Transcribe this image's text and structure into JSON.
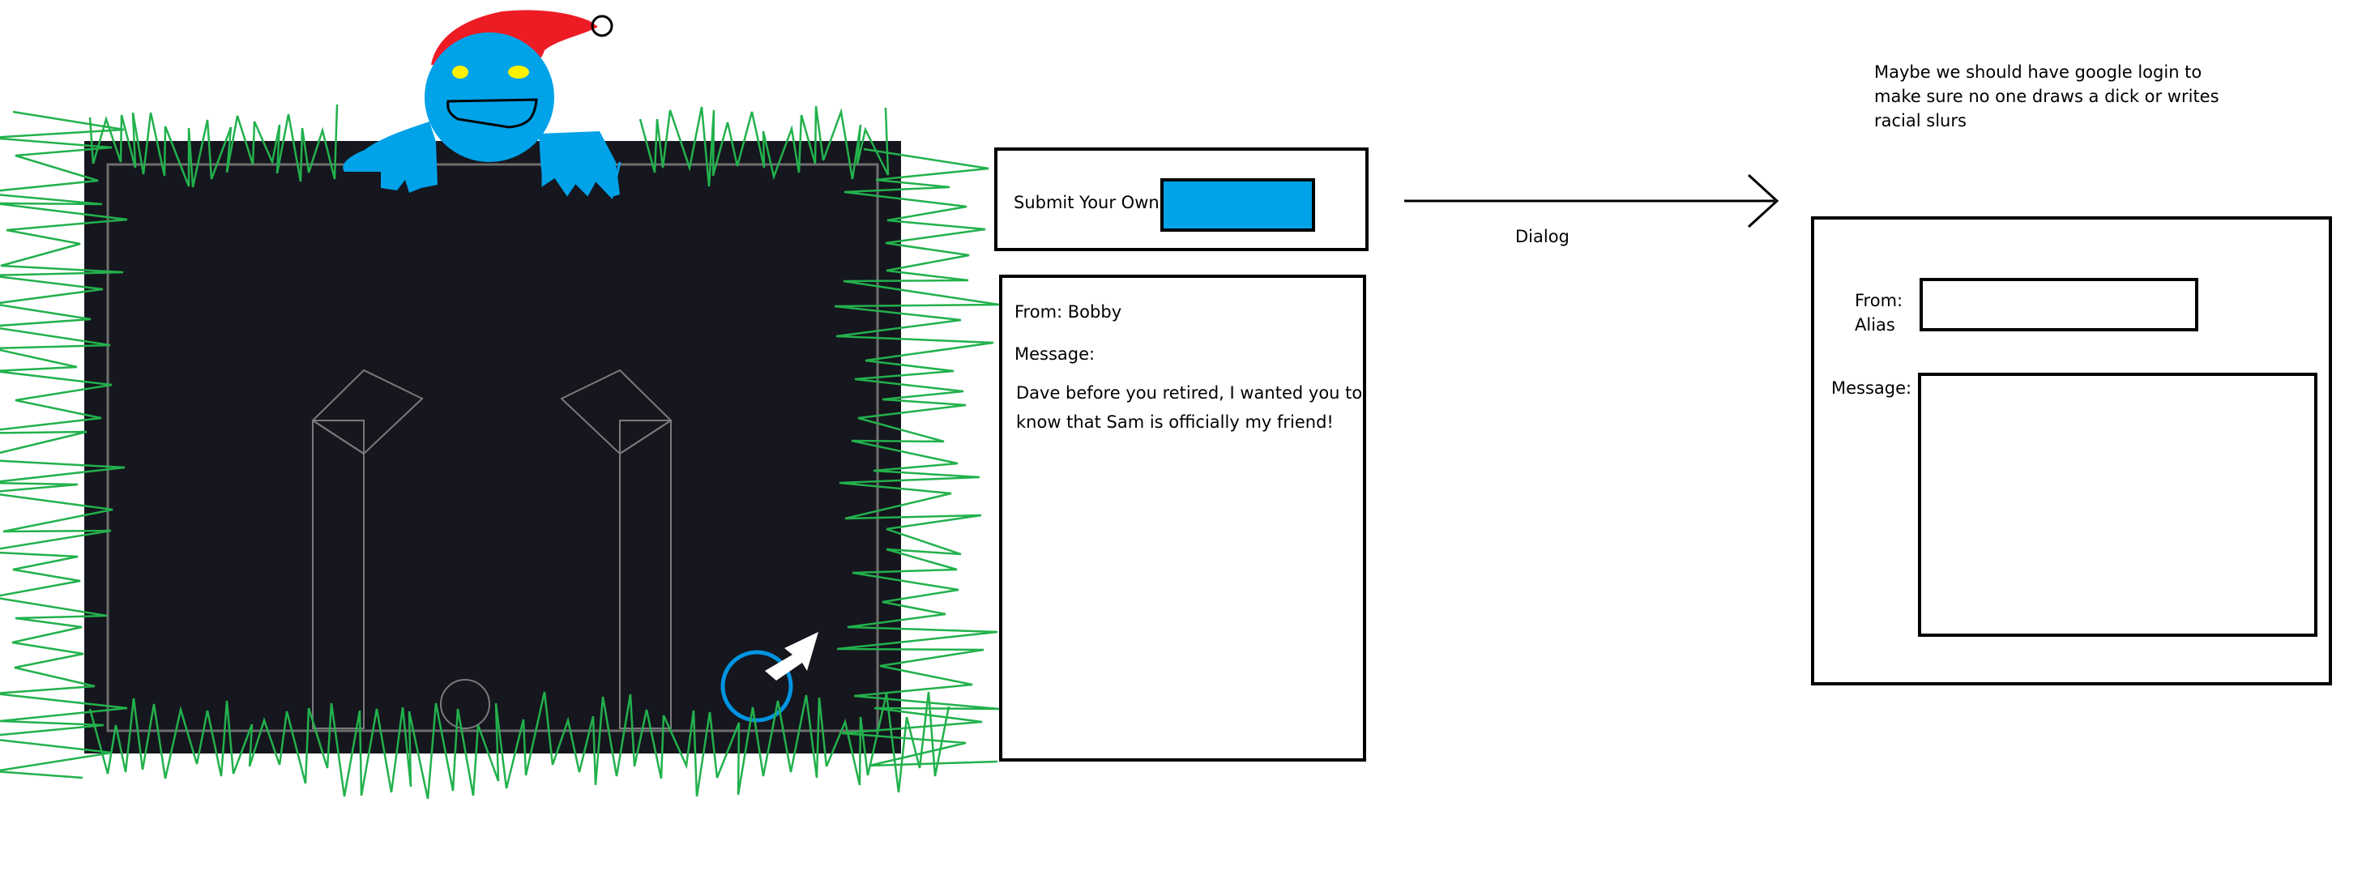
{
  "game_preview": {
    "colors": {
      "background": "#16161e",
      "outline": "#7a7a7a",
      "grass": "#22b14c",
      "character": "#00a2e8",
      "hat": "#ed1c24",
      "eyes": "#fff200",
      "ball": "#0094e0"
    },
    "icons": [
      "character-icon",
      "ball-icon",
      "cursor-arrow-icon"
    ]
  },
  "submit_panel": {
    "label": "Submit Your Own:",
    "button_color": "#00a2e8"
  },
  "message_card": {
    "from": "From: Bobby",
    "message_label": "Message:",
    "message_text": "Dave before you retired, I wanted you to know that Sam is officially my friend!"
  },
  "arrow": {
    "label": "Dialog"
  },
  "note": {
    "lines": [
      "Maybe we should have google login to",
      "make sure no one draws a dick or writes",
      "racial slurs"
    ]
  },
  "dialog": {
    "from_label_1": "From:",
    "from_label_2": "Alias",
    "message_label": "Message:"
  }
}
